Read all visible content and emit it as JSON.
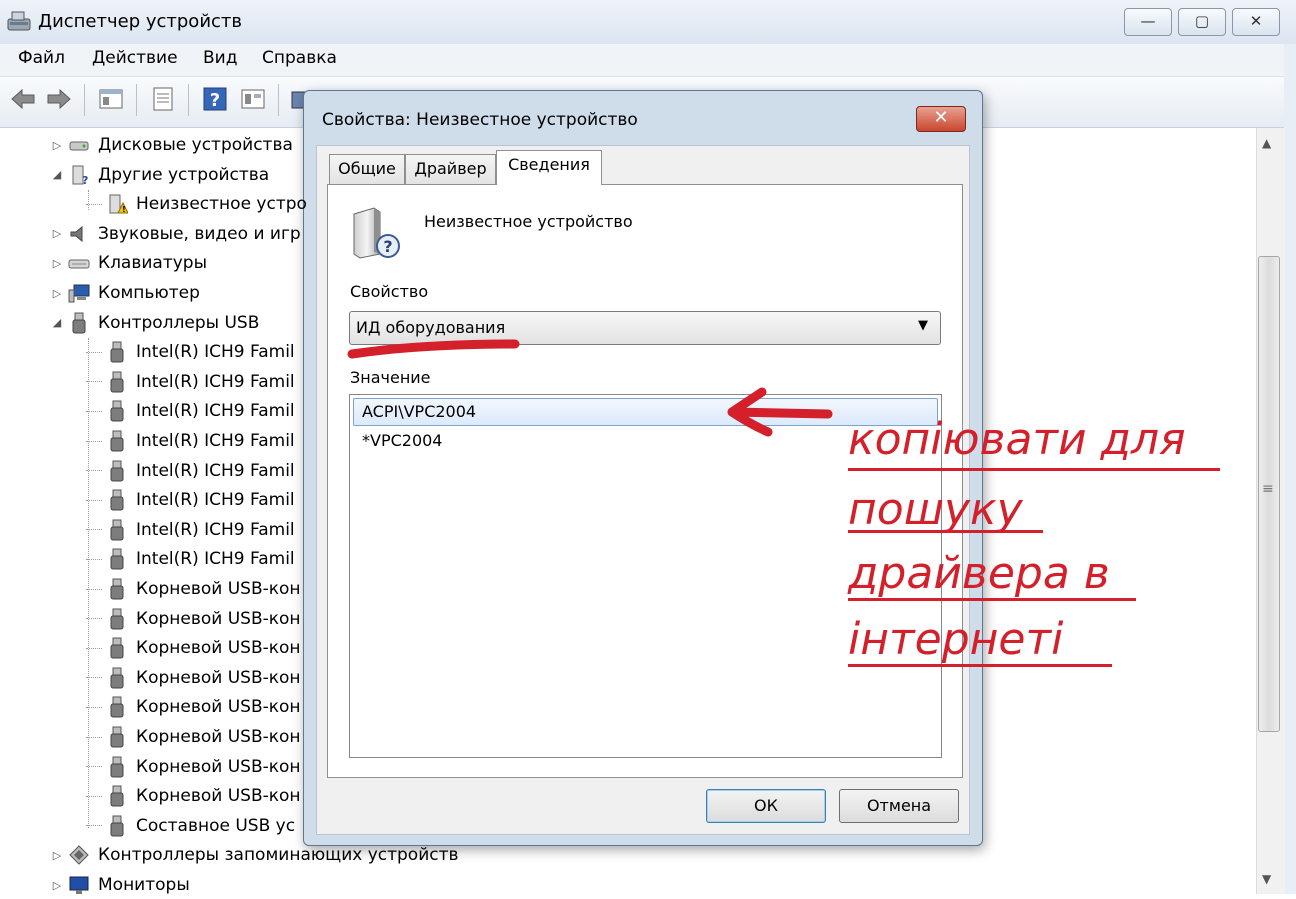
{
  "window": {
    "title": "Диспетчер устройств",
    "controls": {
      "minimize": "—",
      "maximize": "▢",
      "close": "✕"
    }
  },
  "menu": {
    "items": [
      "Файл",
      "Действие",
      "Вид",
      "Справка"
    ]
  },
  "tree": {
    "items": [
      {
        "label": "Дисковые устройства",
        "level": 0,
        "expander": "▷",
        "icon": "disk-drive-icon"
      },
      {
        "label": "Другие устройства",
        "level": 0,
        "expander": "◢",
        "icon": "other-devices-icon"
      },
      {
        "label": "Неизвестное устро",
        "level": 1,
        "expander": "",
        "icon": "warning-device-icon"
      },
      {
        "label": "Звуковые, видео и игр",
        "level": 0,
        "expander": "▷",
        "icon": "speaker-icon"
      },
      {
        "label": "Клавиатуры",
        "level": 0,
        "expander": "▷",
        "icon": "keyboard-icon"
      },
      {
        "label": "Компьютер",
        "level": 0,
        "expander": "▷",
        "icon": "computer-icon"
      },
      {
        "label": "Контроллеры USB",
        "level": 0,
        "expander": "◢",
        "icon": "usb-icon"
      },
      {
        "label": "Intel(R) ICH9 Famil",
        "level": 1,
        "expander": "",
        "icon": "usb-icon"
      },
      {
        "label": "Intel(R) ICH9 Famil",
        "level": 1,
        "expander": "",
        "icon": "usb-icon"
      },
      {
        "label": "Intel(R) ICH9 Famil",
        "level": 1,
        "expander": "",
        "icon": "usb-icon"
      },
      {
        "label": "Intel(R) ICH9 Famil",
        "level": 1,
        "expander": "",
        "icon": "usb-icon"
      },
      {
        "label": "Intel(R) ICH9 Famil",
        "level": 1,
        "expander": "",
        "icon": "usb-icon"
      },
      {
        "label": "Intel(R) ICH9 Famil",
        "level": 1,
        "expander": "",
        "icon": "usb-icon"
      },
      {
        "label": "Intel(R) ICH9 Famil",
        "level": 1,
        "expander": "",
        "icon": "usb-icon"
      },
      {
        "label": "Intel(R) ICH9 Famil",
        "level": 1,
        "expander": "",
        "icon": "usb-icon"
      },
      {
        "label": "Корневой USB-кон",
        "level": 1,
        "expander": "",
        "icon": "usb-icon"
      },
      {
        "label": "Корневой USB-кон",
        "level": 1,
        "expander": "",
        "icon": "usb-icon"
      },
      {
        "label": "Корневой USB-кон",
        "level": 1,
        "expander": "",
        "icon": "usb-icon"
      },
      {
        "label": "Корневой USB-кон",
        "level": 1,
        "expander": "",
        "icon": "usb-icon"
      },
      {
        "label": "Корневой USB-кон",
        "level": 1,
        "expander": "",
        "icon": "usb-icon"
      },
      {
        "label": "Корневой USB-кон",
        "level": 1,
        "expander": "",
        "icon": "usb-icon"
      },
      {
        "label": "Корневой USB-кон",
        "level": 1,
        "expander": "",
        "icon": "usb-icon"
      },
      {
        "label": "Корневой USB-кон",
        "level": 1,
        "expander": "",
        "icon": "usb-icon"
      },
      {
        "label": "Составное USB ус",
        "level": 1,
        "expander": "",
        "icon": "usb-icon"
      },
      {
        "label": "Контроллеры запоминающих устройств",
        "level": 0,
        "expander": "▷",
        "icon": "storage-controller-icon"
      },
      {
        "label": "Мониторы",
        "level": 0,
        "expander": "▷",
        "icon": "monitor-icon"
      }
    ]
  },
  "dialog": {
    "title": "Свойства: Неизвестное устройство",
    "close": "✕",
    "tabs": [
      "Общие",
      "Драйвер",
      "Сведения"
    ],
    "active_tab": "Сведения",
    "device_name": "Неизвестное устройство",
    "property_label": "Свойство",
    "property_value": "ИД оборудования",
    "value_label": "Значение",
    "values": [
      "ACPI\\VPC2004",
      "*VPC2004"
    ],
    "ok": "ОК",
    "cancel": "Отмена"
  },
  "annotation": {
    "lines": [
      "копіювати для",
      "пошуку",
      "драйвера в",
      "інтернеті"
    ],
    "color": "#d3202a"
  }
}
